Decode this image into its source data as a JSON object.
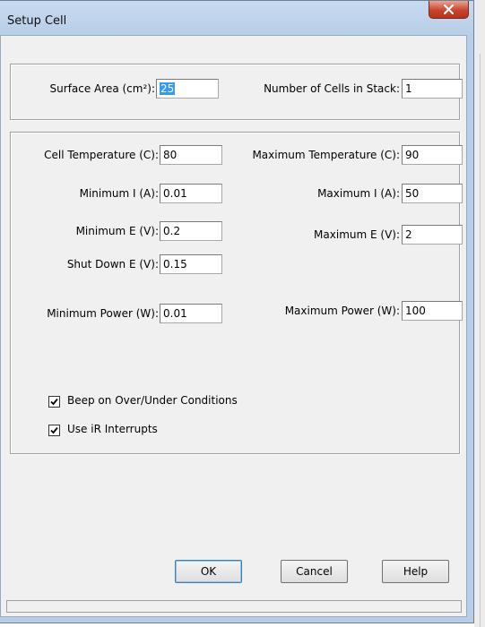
{
  "window": {
    "title": "Setup Cell"
  },
  "top_group": {
    "surface_area": {
      "label": "Surface Area (cm²):",
      "value": "25"
    },
    "cells_in_stack": {
      "label": "Number of Cells in Stack:",
      "value": "1"
    }
  },
  "params": {
    "cell_temperature": {
      "label": "Cell Temperature (C):",
      "value": "80"
    },
    "maximum_temperature": {
      "label": "Maximum Temperature (C):",
      "value": "90"
    },
    "minimum_i": {
      "label": "Minimum I (A):",
      "value": "0.01"
    },
    "maximum_i": {
      "label": "Maximum I (A):",
      "value": "50"
    },
    "minimum_e": {
      "label": "Minimum E (V):",
      "value": "0.2"
    },
    "maximum_e": {
      "label": "Maximum E (V):",
      "value": "2"
    },
    "shut_down_e": {
      "label": "Shut Down E (V):",
      "value": "0.15"
    },
    "minimum_power": {
      "label": "Minimum Power (W):",
      "value": "0.01"
    },
    "maximum_power": {
      "label": "Maximum Power (W):",
      "value": "100"
    }
  },
  "options": {
    "beep": {
      "label": "Beep on Over/Under Conditions",
      "checked": true
    },
    "ir_interrupts": {
      "label": "Use iR Interrupts",
      "checked": true
    }
  },
  "buttons": {
    "ok": "OK",
    "cancel": "Cancel",
    "help": "Help"
  },
  "icons": {
    "close": "close-icon",
    "checkmark": "checkmark-icon"
  },
  "colors": {
    "selection": "#3399ff",
    "close_button": "#c9452e",
    "dialog_face": "#f0f0f0"
  }
}
